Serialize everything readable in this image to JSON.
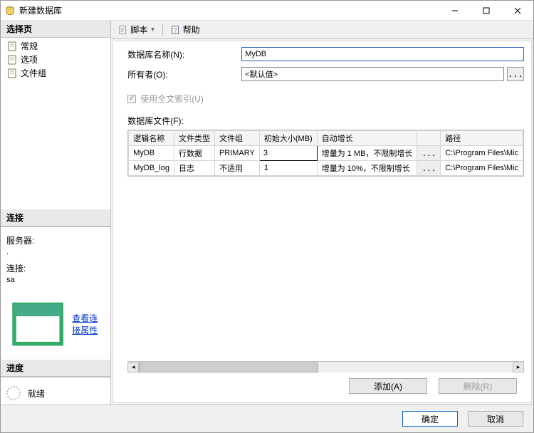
{
  "window": {
    "title": "新建数据库"
  },
  "winbuttons": {
    "min": "minimize",
    "max": "maximize",
    "close": "close"
  },
  "left": {
    "select_page_header": "选择页",
    "nav": {
      "general": "常规",
      "options": "选项",
      "filegroups": "文件组"
    },
    "conn_header": "连接",
    "server_label": "服务器:",
    "server_value": ".",
    "conn_label": "连接:",
    "conn_value": "sa",
    "view_conn_props": "查看连接属性",
    "progress_header": "进度",
    "progress_state": "就绪"
  },
  "toolbar": {
    "script": "脚本",
    "help": "帮助"
  },
  "form": {
    "db_name_label": "数据库名称(N):",
    "db_name_value": "MyDB",
    "owner_label": "所有者(O):",
    "owner_value": "<默认值>",
    "fulltext_label": "使用全文索引(U)",
    "files_label": "数据库文件(F):"
  },
  "grid": {
    "headers": {
      "name": "逻辑名称",
      "ftype": "文件类型",
      "fgroup": "文件组",
      "size": "初始大小(MB)",
      "grow": "自动增长",
      "path": "路径"
    },
    "rows": [
      {
        "name": "MyDB",
        "ftype": "行数据",
        "fgroup": "PRIMARY",
        "size": "3",
        "grow": "增量为 1 MB，不限制增长",
        "path": "C:\\Program Files\\Mic"
      },
      {
        "name": "MyDB_log",
        "ftype": "日志",
        "fgroup": "不适用",
        "size": "1",
        "grow": "增量为 10%，不限制增长",
        "path": "C:\\Program Files\\Mic"
      }
    ],
    "ellipsis": "..."
  },
  "actions": {
    "add": "添加(A)",
    "remove": "删除(R)"
  },
  "footer": {
    "ok": "确定",
    "cancel": "取消"
  }
}
